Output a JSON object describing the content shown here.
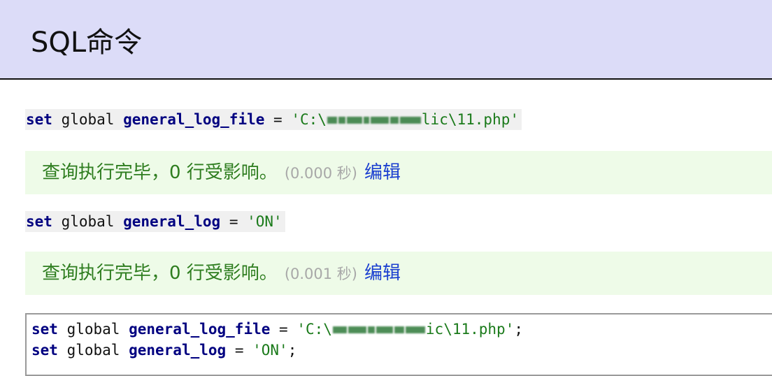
{
  "page_title": "SQL命令",
  "history": [
    {
      "kw_set": "set",
      "word_global": " global ",
      "var_name": "general_log_file",
      "eq": " = ",
      "value_prefix": "'C:\\",
      "value_suffix": "lic\\11.php'"
    },
    {
      "result_text": "查询执行完毕，0 行受影响。",
      "time_text": "(0.000 秒)",
      "edit_label": "编辑"
    },
    {
      "kw_set": "set",
      "word_global": " global ",
      "var_name": "general_log",
      "eq": " = ",
      "value": "'ON'"
    },
    {
      "result_text": "查询执行完毕，0 行受影响。",
      "time_text": "(0.001 秒)",
      "edit_label": "编辑"
    }
  ],
  "editor": {
    "line1": {
      "kw_set": "set",
      "word_global": " global ",
      "var_name": "general_log_file",
      "eq": " = ",
      "value_prefix": "'C:\\",
      "value_suffix": "ic\\11.php'",
      "terminator": ";"
    },
    "line2": {
      "kw_set": "set",
      "word_global": " global ",
      "var_name": "general_log",
      "eq": " = ",
      "value": "'ON'",
      "terminator": ";"
    }
  }
}
